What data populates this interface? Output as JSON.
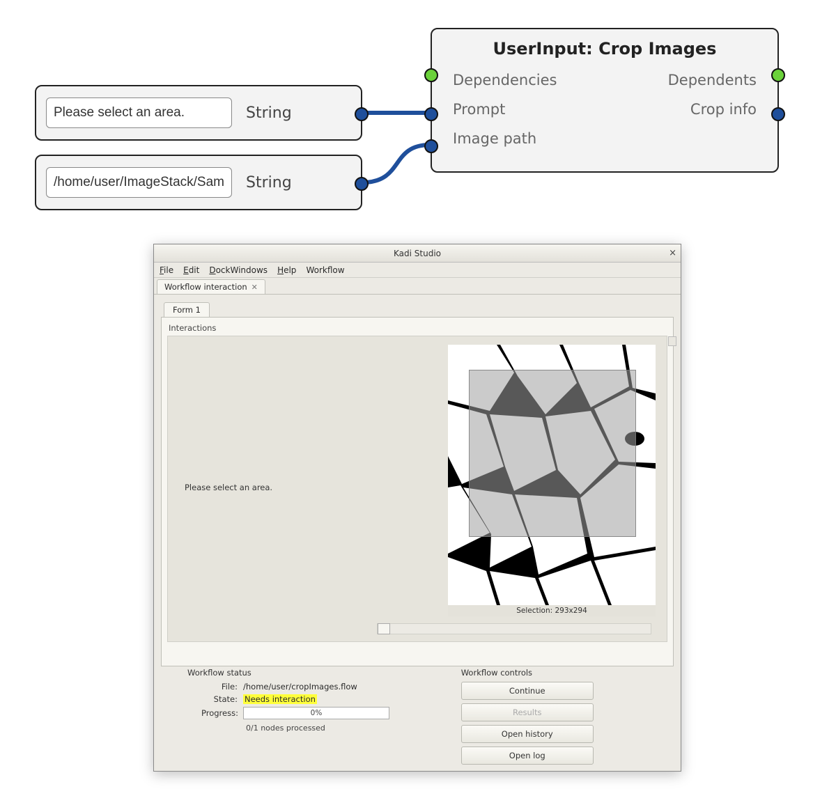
{
  "graph": {
    "string_node_1": {
      "value": "Please select an area.",
      "type": "String"
    },
    "string_node_2": {
      "value": "/home/user/ImageStack/Samples",
      "type": "String"
    },
    "main_node": {
      "title": "UserInput: Crop Images",
      "ports_left": [
        "Dependencies",
        "Prompt",
        "Image path"
      ],
      "ports_right": [
        "Dependents",
        "Crop info"
      ]
    }
  },
  "app": {
    "title": "Kadi Studio",
    "menus": [
      "File",
      "Edit",
      "DockWindows",
      "Help",
      "Workflow"
    ],
    "doc_tab": "Workflow interaction",
    "form_tab": "Form 1",
    "interactions_label": "Interactions",
    "prompt": "Please select an area.",
    "selection_label": "Selection: 293x294",
    "status": {
      "section": "Workflow status",
      "file_k": "File:",
      "file_v": "/home/user/cropImages.flow",
      "state_k": "State:",
      "state_v": "Needs interaction",
      "progress_k": "Progress:",
      "progress_pct": "0%",
      "nodes": "0/1 nodes processed"
    },
    "controls": {
      "section": "Workflow controls",
      "continue": "Continue",
      "results": "Results",
      "open_history": "Open history",
      "open_log": "Open log"
    }
  }
}
